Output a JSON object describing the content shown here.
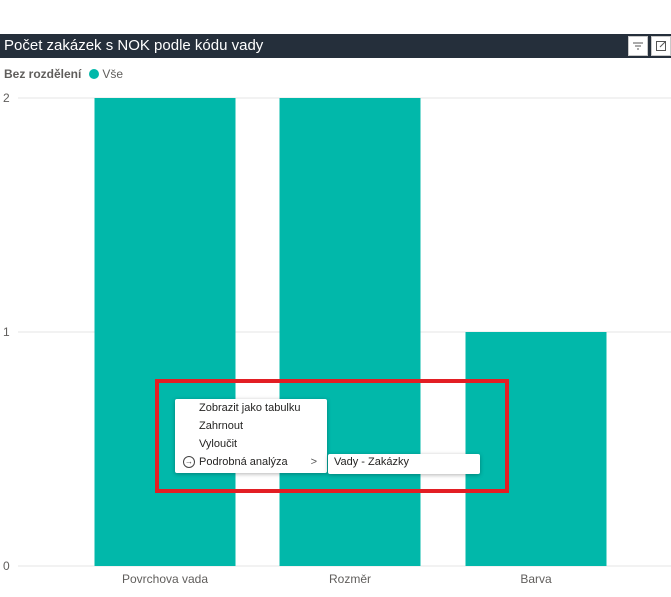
{
  "visual": {
    "title": "Počet zakázek s NOK podle kódu vady",
    "filter_icon": "filter-icon",
    "focus_icon": "focus-mode-icon"
  },
  "legend": {
    "title": "Bez rozdělení",
    "items": [
      {
        "label": "Vše",
        "color": "#01b8aa"
      }
    ]
  },
  "context_menu": {
    "items": [
      {
        "label": "Zobrazit jako tabulku"
      },
      {
        "label": "Zahrnout"
      },
      {
        "label": "Vyloučit"
      },
      {
        "label": "Podrobná analýza",
        "icon": "drillthrough-icon",
        "has_submenu": true
      }
    ],
    "submenu": {
      "items": [
        {
          "label": "Vady - Zakázky"
        }
      ]
    }
  },
  "colors": {
    "bar": "#01b8aa",
    "highlight": "#e31e24",
    "title_bg": "#252f3b"
  },
  "chart_data": {
    "type": "bar",
    "categories": [
      "Povrchova vada",
      "Rozměr",
      "Barva"
    ],
    "values": [
      2,
      2,
      1
    ],
    "ylim": [
      0,
      2
    ],
    "yticks": [
      0,
      1,
      2
    ],
    "grid": true
  }
}
